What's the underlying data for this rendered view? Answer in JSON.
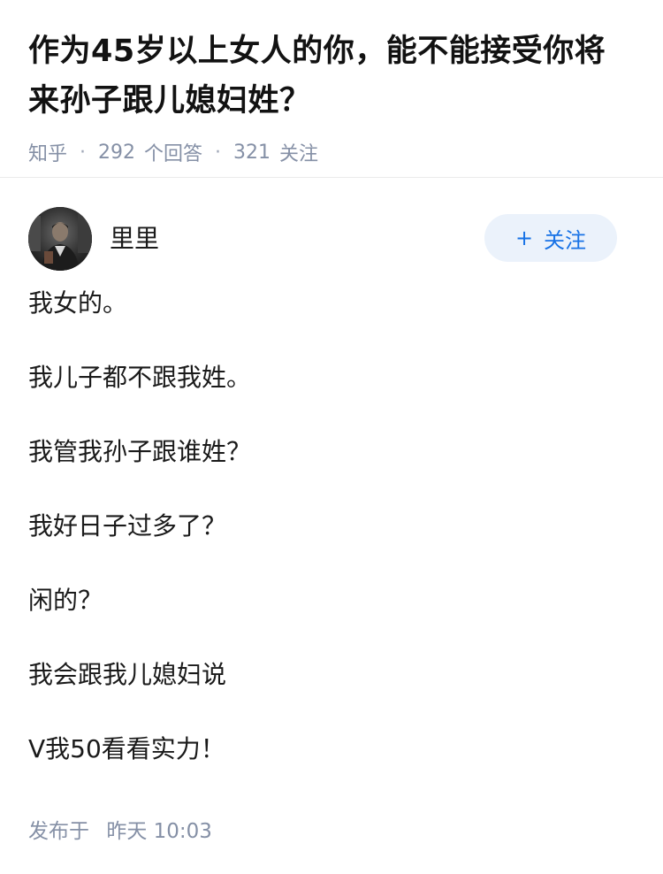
{
  "question": {
    "title": "作为45岁以上女人的你，能不能接受你将来孙子跟儿媳妇姓？",
    "source": "知乎",
    "answer_count": "292",
    "answer_label": "个回答",
    "follower_count": "321",
    "follower_label": "关注"
  },
  "author": {
    "name": "里里",
    "follow_button": "关注",
    "follow_plus": "+"
  },
  "answer": {
    "paragraphs": [
      "我女的。",
      "我儿子都不跟我姓。",
      "我管我孙子跟谁姓？",
      "我好日子过多了？",
      "闲的？",
      "我会跟我儿媳妇说",
      "V我50看看实力！"
    ]
  },
  "footer": {
    "published_label": "发布于",
    "published_time": "昨天 10:03"
  },
  "colors": {
    "meta_text": "#8590a6",
    "accent": "#1772e6",
    "follow_bg": "#ebf2fb"
  }
}
